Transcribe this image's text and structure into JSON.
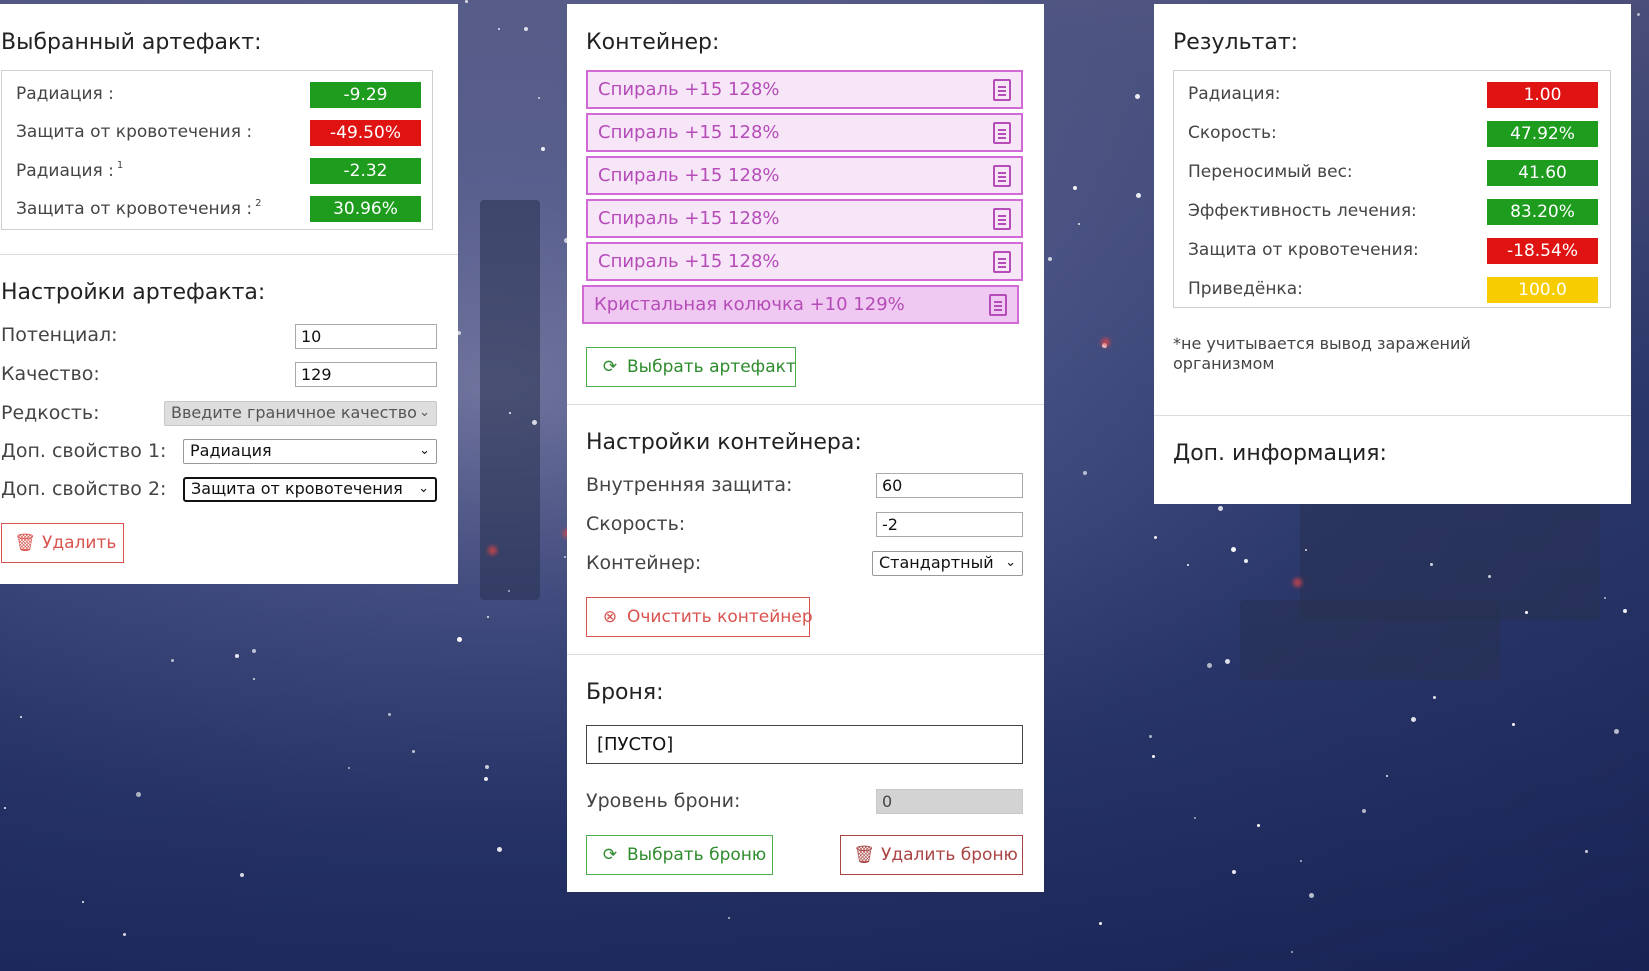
{
  "colors": {
    "green": "#1e9c1e",
    "red": "#e01313",
    "yellow": "#f7cc00",
    "artifact_border": "#d16ad6",
    "artifact_text": "#b54cb8"
  },
  "left": {
    "selected_title": "Выбранный артефакт:",
    "stats": [
      {
        "label": "Радиация :",
        "sup": "",
        "value": "-9.29",
        "color": "green"
      },
      {
        "label": "Защита от кровотечения :",
        "sup": "",
        "value": "-49.50%",
        "color": "red"
      },
      {
        "label": "Радиация :",
        "sup": "1",
        "value": "-2.32",
        "color": "green"
      },
      {
        "label": "Защита от кровотечения :",
        "sup": "2",
        "value": "30.96%",
        "color": "green"
      }
    ],
    "settings_title": "Настройки артефакта:",
    "potential_label": "Потенциал:",
    "potential_value": "10",
    "quality_label": "Качество:",
    "quality_value": "129",
    "rarity_label": "Редкость:",
    "rarity_value": "Введите граничное качество",
    "prop1_label": "Доп. свойство 1:",
    "prop1_value": "Радиация",
    "prop2_label": "Доп. свойство 2:",
    "prop2_value": "Защита от кровотечения",
    "delete_label": "Удалить"
  },
  "middle": {
    "container_title": "Контейнер:",
    "items": [
      {
        "label": "Спираль +15 128%",
        "active": false
      },
      {
        "label": "Спираль +15 128%",
        "active": false
      },
      {
        "label": "Спираль +15 128%",
        "active": false
      },
      {
        "label": "Спираль +15 128%",
        "active": false
      },
      {
        "label": "Спираль +15 128%",
        "active": false
      },
      {
        "label": "Кристальная колючка +10 129%",
        "active": true
      }
    ],
    "select_artifact_label": "Выбрать артефакт",
    "settings_title": "Настройки контейнера:",
    "inner_protection_label": "Внутренняя защита:",
    "inner_protection_value": "60",
    "speed_label": "Скорость:",
    "speed_value": "-2",
    "container_label": "Контейнер:",
    "container_value": "Стандартный",
    "clear_label": "Очистить контейнер",
    "armor_title": "Броня:",
    "armor_value": "[ПУСТО]",
    "armor_level_label": "Уровень брони:",
    "armor_level_value": "0",
    "select_armor_label": "Выбрать броню",
    "delete_armor_label": "Удалить броню"
  },
  "right": {
    "result_title": "Результат:",
    "stats": [
      {
        "label": "Радиация:",
        "value": "1.00",
        "color": "red"
      },
      {
        "label": "Скорость:",
        "value": "47.92%",
        "color": "green"
      },
      {
        "label": "Переносимый вес:",
        "value": "41.60",
        "color": "green"
      },
      {
        "label": "Эффективность лечения:",
        "value": "83.20%",
        "color": "green"
      },
      {
        "label": "Защита от кровотечения:",
        "value": "-18.54%",
        "color": "red"
      },
      {
        "label": "Приведёнка:",
        "value": "100.0",
        "color": "yellow"
      }
    ],
    "note": "*не учитывается вывод заражений организмом",
    "extra_title": "Доп. информация:"
  }
}
